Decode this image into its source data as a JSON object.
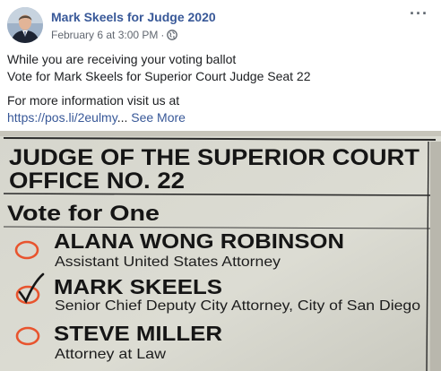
{
  "post": {
    "author": "Mark Skeels for Judge 2020",
    "date": "February 6 at 3:00 PM",
    "separator": "·",
    "more_label": "···",
    "lines": [
      "While you are receiving your voting ballot",
      "Vote for Mark Skeels for Superior Court Judge Seat 22"
    ],
    "info_line": "For more information visit us at",
    "link": "https://pos.li/2eulmy",
    "ellipsis": "...",
    "see_more": "See More"
  },
  "ballot": {
    "title_line1": "JUDGE OF THE SUPERIOR COURT",
    "title_line2": "OFFICE NO. 22",
    "instruction": "Vote for One",
    "candidates": [
      {
        "name": "ALANA WONG ROBINSON",
        "occupation": "Assistant United States Attorney",
        "checked": false
      },
      {
        "name": "MARK SKEELS",
        "occupation": "Senior Chief Deputy City Attorney, City of San Diego",
        "checked": true
      },
      {
        "name": "STEVE MILLER",
        "occupation": "Attorney at Law",
        "checked": false
      }
    ]
  },
  "colors": {
    "link": "#385898",
    "meta": "#616770",
    "oval": "#e8542e",
    "paper": "#d9d9d0"
  },
  "icons": [
    "globe-icon",
    "more-options-icon",
    "checkmark-icon"
  ]
}
